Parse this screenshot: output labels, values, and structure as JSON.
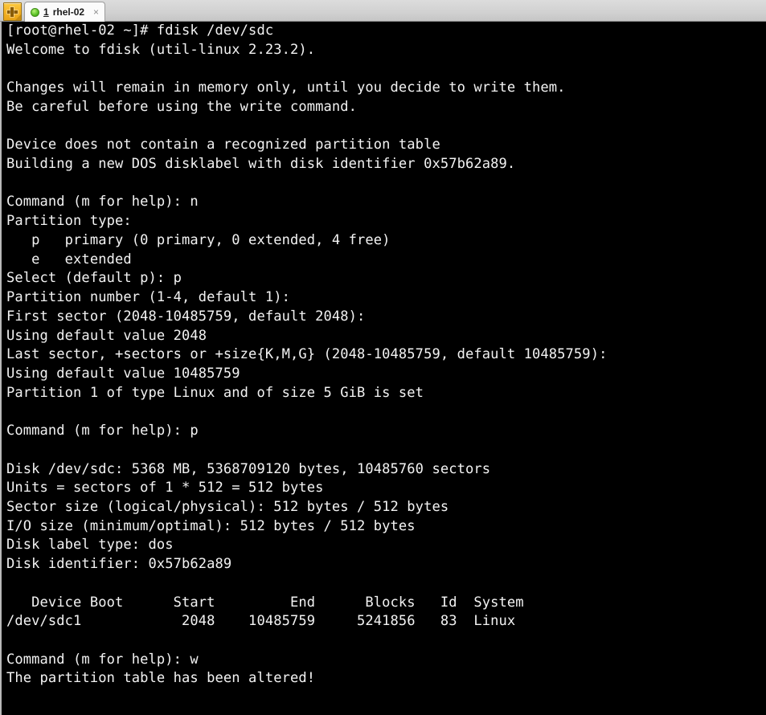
{
  "window": {
    "title": "rhel-02",
    "background_color": "#000000",
    "foreground_color": "#f2f2f2",
    "tabbar_color": "#d4d4d4"
  },
  "tabbar": {
    "new_tab_button": {
      "icon": "plus-icon",
      "tooltip_label": "",
      "color": "#f3b62a"
    },
    "tabs": [
      {
        "index": "1",
        "name": "rhel-02",
        "status_icon": "green-circle-icon",
        "status_color": "#5fc52a",
        "close_label": "×",
        "active": true
      }
    ]
  },
  "terminal": {
    "prompt": "[root@rhel-02 ~]#",
    "command": "fdisk /dev/sdc",
    "lines": [
      "[root@rhel-02 ~]# fdisk /dev/sdc",
      "Welcome to fdisk (util-linux 2.23.2).",
      "",
      "Changes will remain in memory only, until you decide to write them.",
      "Be careful before using the write command.",
      "",
      "Device does not contain a recognized partition table",
      "Building a new DOS disklabel with disk identifier 0x57b62a89.",
      "",
      "Command (m for help): n",
      "Partition type:",
      "   p   primary (0 primary, 0 extended, 4 free)",
      "   e   extended",
      "Select (default p): p",
      "Partition number (1-4, default 1):",
      "First sector (2048-10485759, default 2048):",
      "Using default value 2048",
      "Last sector, +sectors or +size{K,M,G} (2048-10485759, default 10485759):",
      "Using default value 10485759",
      "Partition 1 of type Linux and of size 5 GiB is set",
      "",
      "Command (m for help): p",
      "",
      "Disk /dev/sdc: 5368 MB, 5368709120 bytes, 10485760 sectors",
      "Units = sectors of 1 * 512 = 512 bytes",
      "Sector size (logical/physical): 512 bytes / 512 bytes",
      "I/O size (minimum/optimal): 512 bytes / 512 bytes",
      "Disk label type: dos",
      "Disk identifier: 0x57b62a89",
      "",
      "   Device Boot      Start         End      Blocks   Id  System",
      "/dev/sdc1            2048    10485759     5241856   83  Linux",
      "",
      "Command (m for help): w",
      "The partition table has been altered!"
    ],
    "session_facts": {
      "fdisk_version": "util-linux 2.23.2",
      "device": "/dev/sdc",
      "disk_identifier": "0x57b62a89",
      "disk_label_type": "dos",
      "disk_size_mb": "5368 MB",
      "disk_size_bytes": "5368709120",
      "total_sectors": "10485760",
      "sector_size_logical": "512 bytes",
      "sector_size_physical": "512 bytes",
      "io_size_minimum": "512 bytes",
      "io_size_optimal": "512 bytes",
      "partition_type_selected": "p",
      "partition_number": "1",
      "first_sector": "2048",
      "last_sector": "10485759",
      "partition_size": "5 GiB",
      "final_command": "w"
    },
    "partition_table": {
      "headers": [
        "Device",
        "Boot",
        "Start",
        "End",
        "Blocks",
        "Id",
        "System"
      ],
      "rows": [
        {
          "device": "/dev/sdc1",
          "boot": "",
          "start": "2048",
          "end": "10485759",
          "blocks": "5241856",
          "id": "83",
          "system": "Linux"
        }
      ]
    }
  }
}
